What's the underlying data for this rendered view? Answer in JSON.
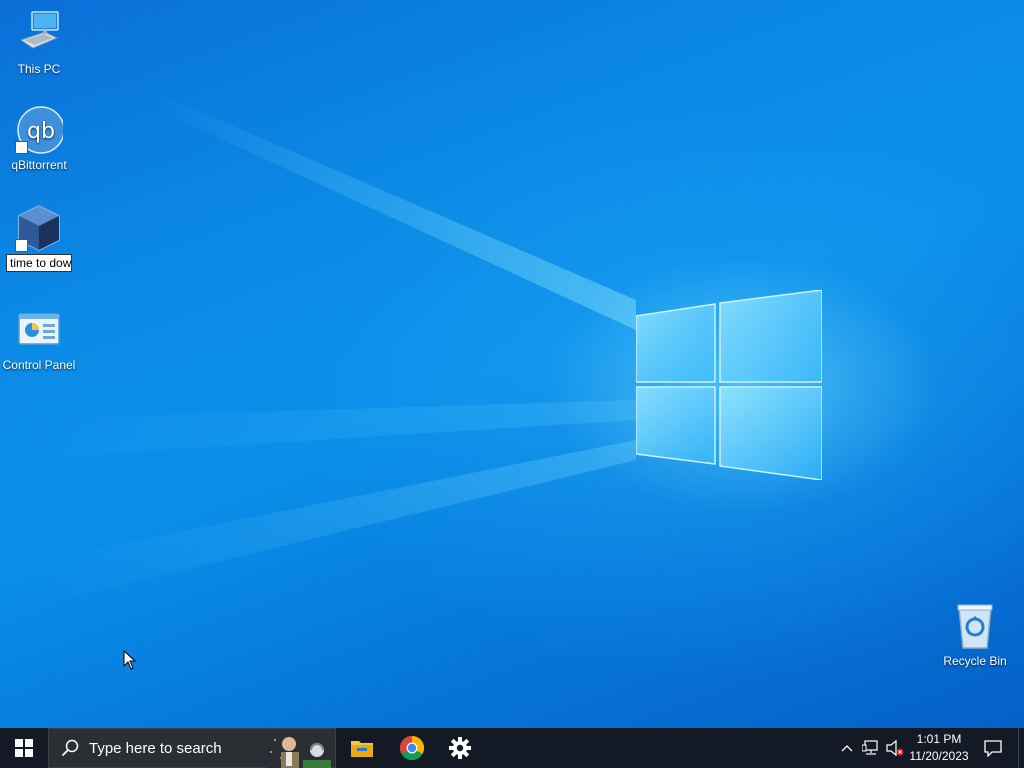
{
  "desktop": {
    "icons": [
      {
        "label": "This PC",
        "icon": "computer-icon"
      },
      {
        "label": "qBittorrent",
        "icon": "qbittorrent-icon"
      },
      {
        "label": "time to dow",
        "icon": "virtualbox-icon",
        "renaming": true
      },
      {
        "label": "Control Panel",
        "icon": "control-panel-icon"
      },
      {
        "label": "Recycle Bin",
        "icon": "recycle-bin-icon"
      }
    ],
    "wallpaper_colors": {
      "base": "#0a86e4",
      "light": "#7fdcff"
    }
  },
  "taskbar": {
    "search_placeholder": "Type here to search",
    "pinned": [
      "file-explorer-icon",
      "chrome-icon",
      "settings-gear-icon"
    ],
    "tray": [
      "chevron-up-icon",
      "network-icon",
      "volume-muted-icon",
      "notification-icon"
    ],
    "clock": {
      "time": "1:01 PM",
      "date": "11/20/2023"
    },
    "background": "#131a25"
  }
}
